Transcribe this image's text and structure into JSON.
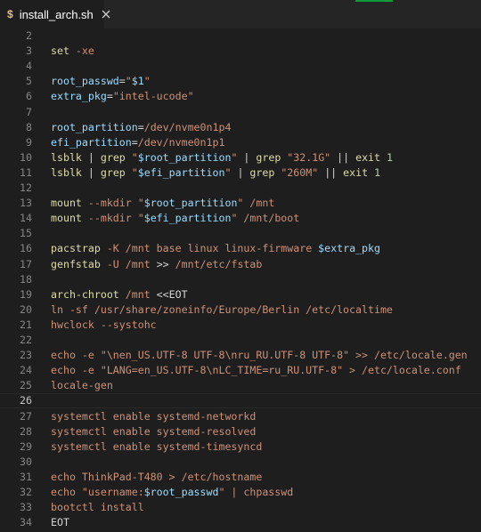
{
  "tab": {
    "icon_glyph": "$",
    "label": "install_arch.sh"
  },
  "colors": {
    "background": "#1e1e1e",
    "tab_strip": "#252526",
    "line_number": "#858585",
    "string": "#ce9178",
    "variable": "#9cdcfe",
    "command": "#dcdcaa",
    "accent": "#0e9b3a"
  },
  "icons": {
    "tab_file_icon": "shell-script-icon",
    "tab_close_icon": "close-icon"
  },
  "editor": {
    "current_line": 26,
    "lines": [
      {
        "number": "2",
        "segments": []
      },
      {
        "number": "3",
        "segments": [
          {
            "t": "cmd",
            "v": "set "
          },
          {
            "t": "flag",
            "v": "-xe"
          }
        ]
      },
      {
        "number": "4",
        "segments": []
      },
      {
        "number": "5",
        "segments": [
          {
            "t": "var",
            "v": "root_passwd"
          },
          {
            "t": "op",
            "v": "="
          },
          {
            "t": "string",
            "v": "\""
          },
          {
            "t": "var",
            "v": "$1"
          },
          {
            "t": "string",
            "v": "\""
          }
        ]
      },
      {
        "number": "6",
        "segments": [
          {
            "t": "var",
            "v": "extra_pkg"
          },
          {
            "t": "op",
            "v": "="
          },
          {
            "t": "string",
            "v": "\"intel-ucode\""
          }
        ]
      },
      {
        "number": "7",
        "segments": []
      },
      {
        "number": "8",
        "segments": [
          {
            "t": "var",
            "v": "root_partition"
          },
          {
            "t": "op",
            "v": "="
          },
          {
            "t": "plain",
            "v": "/dev/nvme0n1p4"
          }
        ]
      },
      {
        "number": "9",
        "segments": [
          {
            "t": "var",
            "v": "efi_partition"
          },
          {
            "t": "op",
            "v": "="
          },
          {
            "t": "plain",
            "v": "/dev/nvme0n1p1"
          }
        ]
      },
      {
        "number": "10",
        "segments": [
          {
            "t": "cmd",
            "v": "lsblk "
          },
          {
            "t": "op",
            "v": "| "
          },
          {
            "t": "cmd",
            "v": "grep "
          },
          {
            "t": "string",
            "v": "\""
          },
          {
            "t": "var",
            "v": "$root_partition"
          },
          {
            "t": "string",
            "v": "\" "
          },
          {
            "t": "op",
            "v": "| "
          },
          {
            "t": "cmd",
            "v": "grep "
          },
          {
            "t": "string",
            "v": "\"32.1G\" "
          },
          {
            "t": "op",
            "v": "|| "
          },
          {
            "t": "cmd",
            "v": "exit "
          },
          {
            "t": "num",
            "v": "1"
          }
        ]
      },
      {
        "number": "11",
        "segments": [
          {
            "t": "cmd",
            "v": "lsblk "
          },
          {
            "t": "op",
            "v": "| "
          },
          {
            "t": "cmd",
            "v": "grep "
          },
          {
            "t": "string",
            "v": "\""
          },
          {
            "t": "var",
            "v": "$efi_partition"
          },
          {
            "t": "string",
            "v": "\" "
          },
          {
            "t": "op",
            "v": "| "
          },
          {
            "t": "cmd",
            "v": "grep "
          },
          {
            "t": "string",
            "v": "\"260M\" "
          },
          {
            "t": "op",
            "v": "|| "
          },
          {
            "t": "cmd",
            "v": "exit "
          },
          {
            "t": "num",
            "v": "1"
          }
        ]
      },
      {
        "number": "12",
        "segments": []
      },
      {
        "number": "13",
        "segments": [
          {
            "t": "cmd",
            "v": "mount "
          },
          {
            "t": "flag",
            "v": "--mkdir "
          },
          {
            "t": "string",
            "v": "\""
          },
          {
            "t": "var",
            "v": "$root_partition"
          },
          {
            "t": "string",
            "v": "\" "
          },
          {
            "t": "plain",
            "v": "/mnt"
          }
        ]
      },
      {
        "number": "14",
        "segments": [
          {
            "t": "cmd",
            "v": "mount "
          },
          {
            "t": "flag",
            "v": "--mkdir "
          },
          {
            "t": "string",
            "v": "\""
          },
          {
            "t": "var",
            "v": "$efi_partition"
          },
          {
            "t": "string",
            "v": "\" "
          },
          {
            "t": "plain",
            "v": "/mnt/boot"
          }
        ]
      },
      {
        "number": "15",
        "segments": []
      },
      {
        "number": "16",
        "segments": [
          {
            "t": "cmd",
            "v": "pacstrap "
          },
          {
            "t": "flag",
            "v": "-K "
          },
          {
            "t": "plain",
            "v": "/mnt base linux linux-firmware "
          },
          {
            "t": "var",
            "v": "$extra_pkg"
          }
        ]
      },
      {
        "number": "17",
        "segments": [
          {
            "t": "cmd",
            "v": "genfstab "
          },
          {
            "t": "flag",
            "v": "-U "
          },
          {
            "t": "plain",
            "v": "/mnt "
          },
          {
            "t": "op",
            "v": ">> "
          },
          {
            "t": "plain",
            "v": "/mnt/etc/fstab"
          }
        ]
      },
      {
        "number": "18",
        "segments": []
      },
      {
        "number": "19",
        "segments": [
          {
            "t": "cmd",
            "v": "arch-chroot "
          },
          {
            "t": "plain",
            "v": "/mnt "
          },
          {
            "t": "op",
            "v": "<<EOT"
          }
        ]
      },
      {
        "number": "20",
        "segments": [
          {
            "t": "plain",
            "v": "ln -sf /usr/share/zoneinfo/Europe/Berlin /etc/localtime"
          }
        ]
      },
      {
        "number": "21",
        "segments": [
          {
            "t": "plain",
            "v": "hwclock --systohc"
          }
        ]
      },
      {
        "number": "22",
        "segments": []
      },
      {
        "number": "23",
        "segments": [
          {
            "t": "plain",
            "v": "echo -e \"\\nen_US.UTF-8 UTF-8\\nru_RU.UTF-8 UTF-8\" >> /etc/locale.gen"
          }
        ]
      },
      {
        "number": "24",
        "segments": [
          {
            "t": "plain",
            "v": "echo -e \"LANG=en_US.UTF-8\\nLC_TIME=ru_RU.UTF-8\" > /etc/locale.conf"
          }
        ]
      },
      {
        "number": "25",
        "segments": [
          {
            "t": "plain",
            "v": "locale-gen"
          }
        ]
      },
      {
        "number": "26",
        "segments": []
      },
      {
        "number": "27",
        "segments": [
          {
            "t": "plain",
            "v": "systemctl enable systemd-networkd"
          }
        ]
      },
      {
        "number": "28",
        "segments": [
          {
            "t": "plain",
            "v": "systemctl enable systemd-resolved"
          }
        ]
      },
      {
        "number": "29",
        "segments": [
          {
            "t": "plain",
            "v": "systemctl enable systemd-timesyncd"
          }
        ]
      },
      {
        "number": "30",
        "segments": []
      },
      {
        "number": "31",
        "segments": [
          {
            "t": "plain",
            "v": "echo ThinkPad-T480 > /etc/hostname"
          }
        ]
      },
      {
        "number": "32",
        "segments": [
          {
            "t": "plain",
            "v": "echo \"username:"
          },
          {
            "t": "var",
            "v": "$root_passwd"
          },
          {
            "t": "plain",
            "v": "\" | chpasswd"
          }
        ]
      },
      {
        "number": "33",
        "segments": [
          {
            "t": "plain",
            "v": "bootctl install"
          }
        ]
      },
      {
        "number": "34",
        "segments": [
          {
            "t": "op",
            "v": "EOT"
          }
        ]
      }
    ]
  }
}
